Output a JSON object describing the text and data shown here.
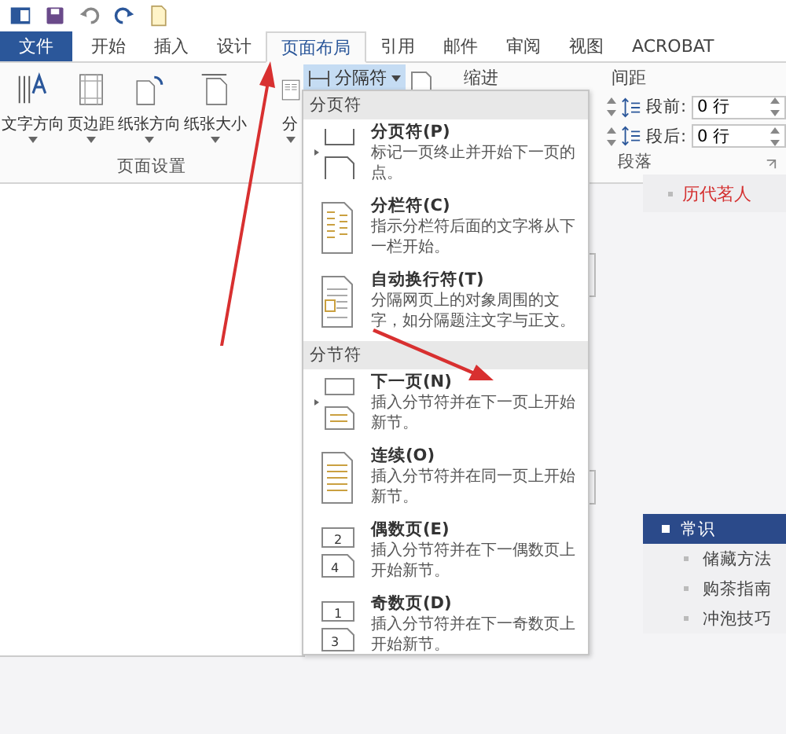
{
  "tabs": [
    {
      "label": "文件",
      "kind": "file",
      "selected": false
    },
    {
      "label": "开始",
      "kind": "tab",
      "selected": false
    },
    {
      "label": "插入",
      "kind": "tab",
      "selected": false
    },
    {
      "label": "设计",
      "kind": "tab",
      "selected": false
    },
    {
      "label": "页面布局",
      "kind": "tab",
      "selected": true
    },
    {
      "label": "引用",
      "kind": "tab",
      "selected": false
    },
    {
      "label": "邮件",
      "kind": "tab",
      "selected": false
    },
    {
      "label": "审阅",
      "kind": "tab",
      "selected": false
    },
    {
      "label": "视图",
      "kind": "tab",
      "selected": false
    },
    {
      "label": "ACROBAT",
      "kind": "tab",
      "selected": false
    }
  ],
  "page_setup": {
    "buttons": [
      {
        "label": "文字方向",
        "kind": "text_direction"
      },
      {
        "label": "页边距",
        "kind": "margins"
      },
      {
        "label": "纸张方向",
        "kind": "orientation"
      },
      {
        "label": "纸张大小",
        "kind": "size"
      },
      {
        "label": "分",
        "kind": "columns"
      }
    ],
    "group_label": "页面设置"
  },
  "breaks_button": {
    "label": "分隔符",
    "expanded": true
  },
  "paragraph": {
    "indent_label": "缩进",
    "spacing_label": "间距",
    "fields": [
      {
        "label": "段前:",
        "value": "0 行"
      },
      {
        "label": "段后:",
        "value": "0 行"
      }
    ],
    "group_label": "段落"
  },
  "menu": {
    "sections": [
      {
        "header": "分页符",
        "items": [
          {
            "title": "分页符(P)",
            "description": "标记一页终止并开始下一页的点。",
            "kind": "page_break"
          },
          {
            "title": "分栏符(C)",
            "description": "指示分栏符后面的文字将从下一栏开始。",
            "kind": "column_break"
          },
          {
            "title": "自动换行符(T)",
            "description": "分隔网页上的对象周围的文字，如分隔题注文字与正文。",
            "kind": "text_wrap"
          }
        ]
      },
      {
        "header": "分节符",
        "items": [
          {
            "title": "下一页(N)",
            "description": "插入分节符并在下一页上开始新节。",
            "kind": "next_page"
          },
          {
            "title": "连续(O)",
            "description": "插入分节符并在同一页上开始新节。",
            "kind": "continuous"
          },
          {
            "title": "偶数页(E)",
            "description": "插入分节符并在下一偶数页上开始新节。",
            "kind": "numbered",
            "icon_numbers": [
              "2",
              "4"
            ]
          },
          {
            "title": "奇数页(D)",
            "description": "插入分节符并在下一奇数页上开始新节。",
            "kind": "numbered",
            "icon_numbers": [
              "1",
              "3"
            ]
          }
        ]
      }
    ]
  },
  "document": {
    "side_title": "历代茗人",
    "nav": {
      "header": "常识",
      "items": [
        "储藏方法",
        "购茶指南",
        "冲泡技巧"
      ]
    }
  }
}
